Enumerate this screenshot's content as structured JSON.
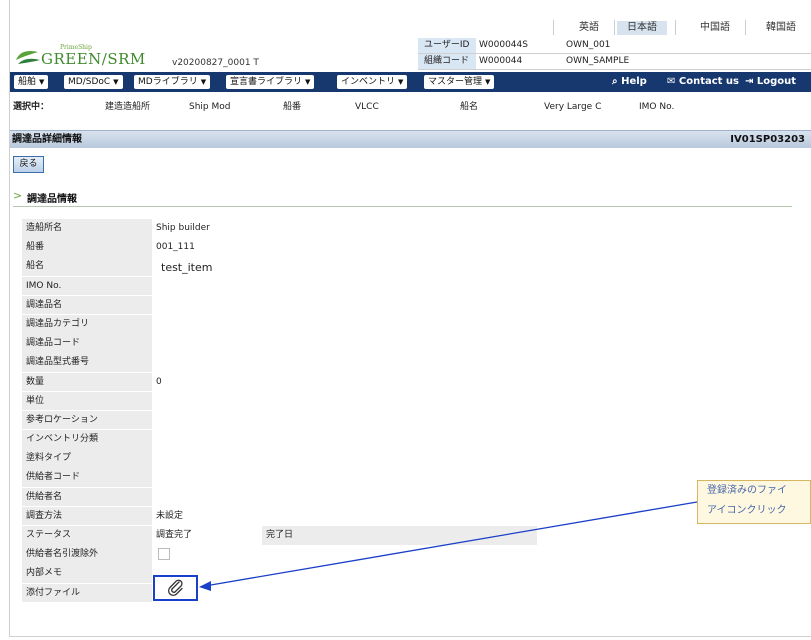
{
  "languages": [
    {
      "label": "英語",
      "active": false
    },
    {
      "label": "日本語",
      "active": true
    },
    {
      "label": "中国語",
      "active": false
    },
    {
      "label": "韓国語",
      "active": false
    }
  ],
  "logo": {
    "subtitle": "PrimeShip",
    "name": "GREEN/SRM"
  },
  "version": "v20200827_0001 T",
  "user": {
    "user_id_label": "ユーザーID",
    "user_id": "W000044S",
    "user_id_extra": "OWN_001",
    "org_code_label": "組織コード",
    "org_code": "W000044",
    "org_code_extra": "OWN_SAMPLE"
  },
  "menu": {
    "items": [
      "船舶",
      "MD/SDoC",
      "MDライブラリ",
      "宣言書ライブラリ",
      "インベントリ",
      "マスター管理"
    ],
    "help": "Help",
    "contact": "Contact us",
    "logout": "Logout"
  },
  "selection": {
    "label": "選択中：",
    "builder_label": "建造造船所",
    "builder": "Ship Mod",
    "ship_no_label": "船番",
    "ship_no": "VLCC",
    "ship_name_label": "船名",
    "ship_name": "Very Large C",
    "imo_label": "IMO No."
  },
  "page": {
    "title": "調達品詳細情報",
    "screen_code": "IV01SP03203"
  },
  "back_button": "戻る",
  "section_title": "調達品情報",
  "fields": [
    {
      "label": "造船所名",
      "value": "Ship builder"
    },
    {
      "label": "船番",
      "value": "001_111"
    },
    {
      "label": "船名",
      "value": "test_item"
    },
    {
      "label": "IMO No.",
      "value": ""
    },
    {
      "label": "調達品名",
      "value": ""
    },
    {
      "label": "調達品カテゴリ",
      "value": ""
    },
    {
      "label": "調達品コード",
      "value": ""
    },
    {
      "label": "調達品型式番号",
      "value": ""
    },
    {
      "label": "数量",
      "value": "0"
    },
    {
      "label": "単位",
      "value": ""
    },
    {
      "label": "参考ロケーション",
      "value": ""
    },
    {
      "label": "インベントリ分類",
      "value": ""
    },
    {
      "label": "塗料タイプ",
      "value": ""
    },
    {
      "label": "供給者コード",
      "value": ""
    },
    {
      "label": "供給者名",
      "value": ""
    },
    {
      "label": "調査方法",
      "value": "未設定"
    },
    {
      "label": "ステータス",
      "value": "調査完了",
      "extra_label": "完了日"
    },
    {
      "label": "供給者名引渡除外",
      "value": ""
    },
    {
      "label": "内部メモ",
      "value": ""
    },
    {
      "label": "添付ファイル",
      "value": ""
    }
  ],
  "tooltip": {
    "line1": "登録済みのファイ",
    "line2": "アイコンクリック"
  },
  "colors": {
    "menu_bg": "#16386f",
    "accent": "#1a3fc8",
    "header_bg": "#c9d6e6"
  }
}
